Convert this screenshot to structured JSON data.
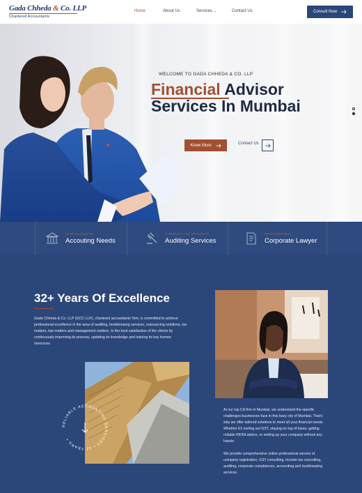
{
  "header": {
    "logo_main": "Gada Chheda",
    "logo_amp": "&",
    "logo_tail": "Co. LLP",
    "logo_sub": "Chartered Accountants",
    "nav": {
      "home": "Home",
      "about": "About Us",
      "services": "Services",
      "contact": "Contact Us"
    },
    "consult_label": "Consult Now"
  },
  "hero": {
    "welcome": "WELCOME TO GADA CHHEDA & CO. LLP",
    "title_accent": "Financial",
    "title_rest": "Advisor",
    "title_line2": "Services In Mumbai",
    "know_more": "Know More",
    "contact_us": "Contact Us"
  },
  "strip": [
    {
      "kicker": "SPECIALIZED IN",
      "title": "Accouting Needs",
      "icon": "bank-icon"
    },
    {
      "kicker": "INTERNAL AND EXTERNAL",
      "title": "Auditing Services",
      "icon": "gavel-icon"
    },
    {
      "kicker": "PROFESSIONAL",
      "title": "Corporate Lawyer",
      "icon": "document-icon"
    }
  ],
  "excellence": {
    "title": "32+ Years Of Excellence",
    "body": "Gada Chheda & Co. LLP (GCC LLP), chartered accountants' firm, is committed to achieve professional excellence in the area of auditing, bookkeeping services, outsourcing solutions, tax matters, law matters and management matters, to the best satisfaction of the clients by continuously improving its process, updating its knowledge and training its key human resources.",
    "badge_text": "RELIABLE ACCOUNTING SERVICES • 32 YEARS •",
    "para1": "At our top CA firm in Mumbai, we understand the specific challenges businesses face in this busy city of Mumbai. That's why we offer tailored solutions to meet all your financial needs. Whether it's sorting out GST, staying on top of taxes, getting reliable RERA advice, or setting up your company without any hassle.",
    "para2": "We provide comprehensive online professional service of company registration, GST consulting, income tax consulting, auditing, corporate compliances, accounting and bookkeeping services."
  },
  "colors": {
    "navy": "#2b4679",
    "rust": "#a24f31",
    "dark_text": "#1d2a44"
  }
}
